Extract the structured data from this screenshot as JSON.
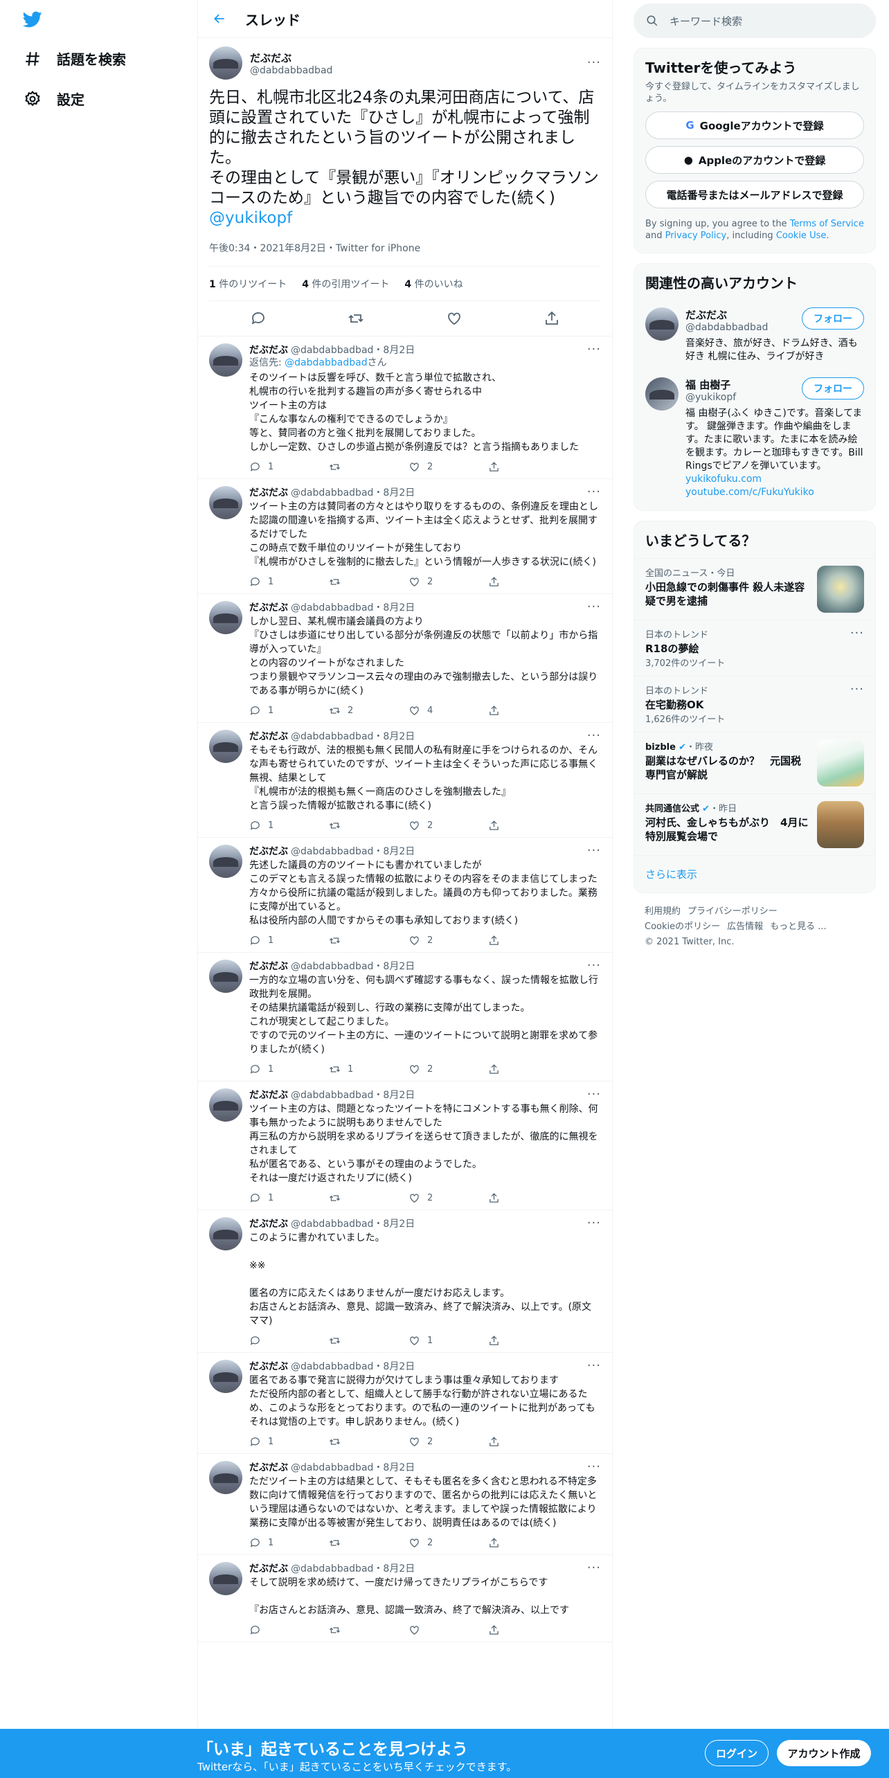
{
  "nav": {
    "explore": "話題を検索",
    "settings": "設定"
  },
  "header": {
    "title": "スレッド"
  },
  "focal": {
    "name": "だぶだぶ",
    "handle": "@dabdabbadbad",
    "text": "先日、札幌市北区北24条の丸果河田商店について、店頭に設置されていた『ひさし』が札幌市によって強制的に撤去されたという旨のツイートが公開されました。\nその理由として『景観が悪い』『オリンピックマラソンコースのため』という趣旨での内容でした(続く)",
    "mention": "@yukikopf",
    "meta": "午後0:34・2021年8月2日・Twitter for iPhone",
    "retweets_n": "1",
    "retweets_label": "件のリツイート",
    "quotes_n": "4",
    "quotes_label": "件の引用ツイート",
    "likes_n": "4",
    "likes_label": "件のいいね"
  },
  "replies": [
    {
      "name": "だぶだぶ",
      "handle": "@dabdabbadbad・8月2日",
      "replyto_prefix": "返信先: ",
      "replyto_link": "@dabdabbadbad",
      "replyto_suffix": "さん",
      "text": "そのツイートは反響を呼び、数千と言う単位で拡散され、\n札幌市の行いを批判する趣旨の声が多く寄せられる中\nツイート主の方は\n『こんな事なんの権利でできるのでしょうか』\n等と、賛同者の方と強く批判を展開しておりました。\nしかし一定数、ひさしの歩道占拠が条例違反では？と言う指摘もありました",
      "reply": "1",
      "rt": "",
      "like": "2"
    },
    {
      "name": "だぶだぶ",
      "handle": "@dabdabbadbad・8月2日",
      "text": "ツイート主の方は賛同者の方々とはやり取りをするものの、条例違反を理由とした認識の間違いを指摘する声、ツイート主は全く応えようとせず、批判を展開するだけでした\nこの時点で数千単位のリツイートが発生しており\n『札幌市がひさしを強制的に撤去した』という情報が一人歩きする状況に(続く)",
      "reply": "1",
      "rt": "",
      "like": "2"
    },
    {
      "name": "だぶだぶ",
      "handle": "@dabdabbadbad・8月2日",
      "text": "しかし翌日、某札幌市議会議員の方より\n『ひさしは歩道にせり出している部分が条例違反の状態で「以前より」市から指導が入っていた』\nとの内容のツイートがなされました\nつまり景観やマラソンコース云々の理由のみで強制撤去した、という部分は誤りである事が明らかに(続く)",
      "reply": "1",
      "rt": "2",
      "like": "4"
    },
    {
      "name": "だぶだぶ",
      "handle": "@dabdabbadbad・8月2日",
      "text": "そもそも行政が、法的根拠も無く民間人の私有財産に手をつけられるのか、そんな声も寄せられていたのですが、ツイート主は全くそういった声に応じる事無く無視、結果として\n『札幌市が法的根拠も無く一商店のひさしを強制撤去した』\nと言う誤った情報が拡散される事に(続く)",
      "reply": "1",
      "rt": "",
      "like": "2"
    },
    {
      "name": "だぶだぶ",
      "handle": "@dabdabbadbad・8月2日",
      "text": "先述した議員の方のツイートにも書かれていましたが\nこのデマとも言える誤った情報の拡散によりその内容をそのまま信じてしまった方々から役所に抗議の電話が殺到しました。議員の方も仰っておりました。業務に支障が出ていると。\n私は役所内部の人間ですからその事も承知しております(続く)",
      "reply": "1",
      "rt": "",
      "like": "2"
    },
    {
      "name": "だぶだぶ",
      "handle": "@dabdabbadbad・8月2日",
      "text": "一方的な立場の言い分を、何も調べず確認する事もなく、誤った情報を拡散し行政批判を展開。\nその結果抗議電話が殺到し、行政の業務に支障が出てしまった。\nこれが現実として起こりました。\nですので元のツイート主の方に、一連のツイートについて説明と謝罪を求めて参りましたが(続く)",
      "reply": "1",
      "rt": "1",
      "like": "2"
    },
    {
      "name": "だぶだぶ",
      "handle": "@dabdabbadbad・8月2日",
      "text": "ツイート主の方は、問題となったツイートを特にコメントする事も無く削除、何事も無かったように説明もありませんでした\n再三私の方から説明を求めるリプライを送らせて頂きましたが、徹底的に無視をされまして\n私が匿名である、という事がその理由のようでした。\nそれは一度だけ返されたリプに(続く)",
      "reply": "1",
      "rt": "",
      "like": "2"
    },
    {
      "name": "だぶだぶ",
      "handle": "@dabdabbadbad・8月2日",
      "text": "このように書かれていました。\n\n※※\n\n匿名の方に応えたくはありませんが一度だけお応えします。\nお店さんとお話済み、意見、認識一致済み、終了で解決済み、以上です。(原文ママ)",
      "reply": "",
      "rt": "",
      "like": "1"
    },
    {
      "name": "だぶだぶ",
      "handle": "@dabdabbadbad・8月2日",
      "text": "匿名である事で発言に説得力が欠けてしまう事は重々承知しております\nただ役所内部の者として、組織人として勝手な行動が許されない立場にあるため、このような形をとっております。ので私の一連のツイートに批判があってもそれは覚悟の上です。申し訳ありません。(続く)",
      "reply": "1",
      "rt": "",
      "like": "2"
    },
    {
      "name": "だぶだぶ",
      "handle": "@dabdabbadbad・8月2日",
      "text": "ただツイート主の方は結果として、そもそも匿名を多く含むと思われる不特定多数に向けて情報発信を行っておりますので、匿名からの批判には応えたく無いという理屈は通らないのではないか、と考えます。ましてや誤った情報拡散により業務に支障が出る等被害が発生しており、説明責任はあるのでは(続く)",
      "reply": "1",
      "rt": "",
      "like": "2"
    },
    {
      "name": "だぶだぶ",
      "handle": "@dabdabbadbad・8月2日",
      "text": "そして説明を求め続けて、一度だけ帰ってきたリプライがこちらです\n\n『お店さんとお話済み、意見、認識一致済み、終了で解決済み、以上です",
      "reply": "",
      "rt": "",
      "like": ""
    }
  ],
  "right": {
    "search_placeholder": "キーワード検索",
    "signup_title": "Twitterを使ってみよう",
    "signup_sub": "今すぐ登録して、タイムラインをカスタマイズしましょう。",
    "google_btn": "Googleアカウントで登録",
    "apple_btn": "Appleのアカウントで登録",
    "phone_btn": "電話番号またはメールアドレスで登録",
    "fine_1": "By signing up, you agree to the ",
    "fine_tos": "Terms of Service",
    "fine_2": " and ",
    "fine_pp": "Privacy Policy",
    "fine_3": ", including ",
    "fine_cookie": "Cookie Use",
    "fine_4": ".",
    "related_title": "関連性の高いアカウント",
    "accounts": [
      {
        "name": "だぶだぶ",
        "handle": "@dabdabbadbad",
        "follow": "フォロー",
        "bio": "音楽好き、旅が好き、ドラム好き、酒も好き 札幌に住み、ライブが好き"
      },
      {
        "name": "福 由樹子",
        "handle": "@yukikopf",
        "follow": "フォロー",
        "bio": "福 由樹子(ふく ゆきこ)です。音楽してます。 鍵盤弾きます。作曲や編曲をします。たまに歌います。たまに本を読み絵を観ます。カレーと珈琲もすきです。Bill Ringsでピアノを弾いています。",
        "link1": "yukikofuku.com",
        "link2": "youtube.com/c/FukuYukiko"
      }
    ],
    "trends_title": "いまどうしてる？",
    "trends": [
      {
        "context": "全国のニュース・今日",
        "title": "小田急線での刺傷事件 殺人未遂容疑で男を逮捕",
        "count": ""
      },
      {
        "context": "日本のトレンド",
        "title": "R18の夢絵",
        "count": "3,702件のツイート"
      },
      {
        "context": "日本のトレンド",
        "title": "在宅勤務OK",
        "count": "1,626件のツイート"
      },
      {
        "context_pre": "bizble",
        "context": "・昨夜",
        "title": "副業はなぜバレるのか？　元国税専門官が解説",
        "count": ""
      },
      {
        "context_pre": "共同通信公式",
        "context": "・昨日",
        "title": "河村氏、金しゃちもがぶり　4月に特別展覧会場で",
        "count": ""
      }
    ],
    "show_more": "さらに表示",
    "footer_links": [
      "利用規約",
      "プライバシーポリシー",
      "Cookieのポリシー",
      "広告情報",
      "もっと見る ..."
    ],
    "copyright": "© 2021 Twitter, Inc."
  },
  "banner": {
    "title": "「いま」起きていることを見つけよう",
    "subtitle": "Twitterなら、「いま」起きていることをいち早くチェックできます。",
    "login": "ログイン",
    "signup": "アカウント作成"
  },
  "colors": {
    "accent": "#1d9bf0",
    "banner_bg": "#1d9bf0",
    "text": "#0f1419",
    "muted": "#536471"
  }
}
